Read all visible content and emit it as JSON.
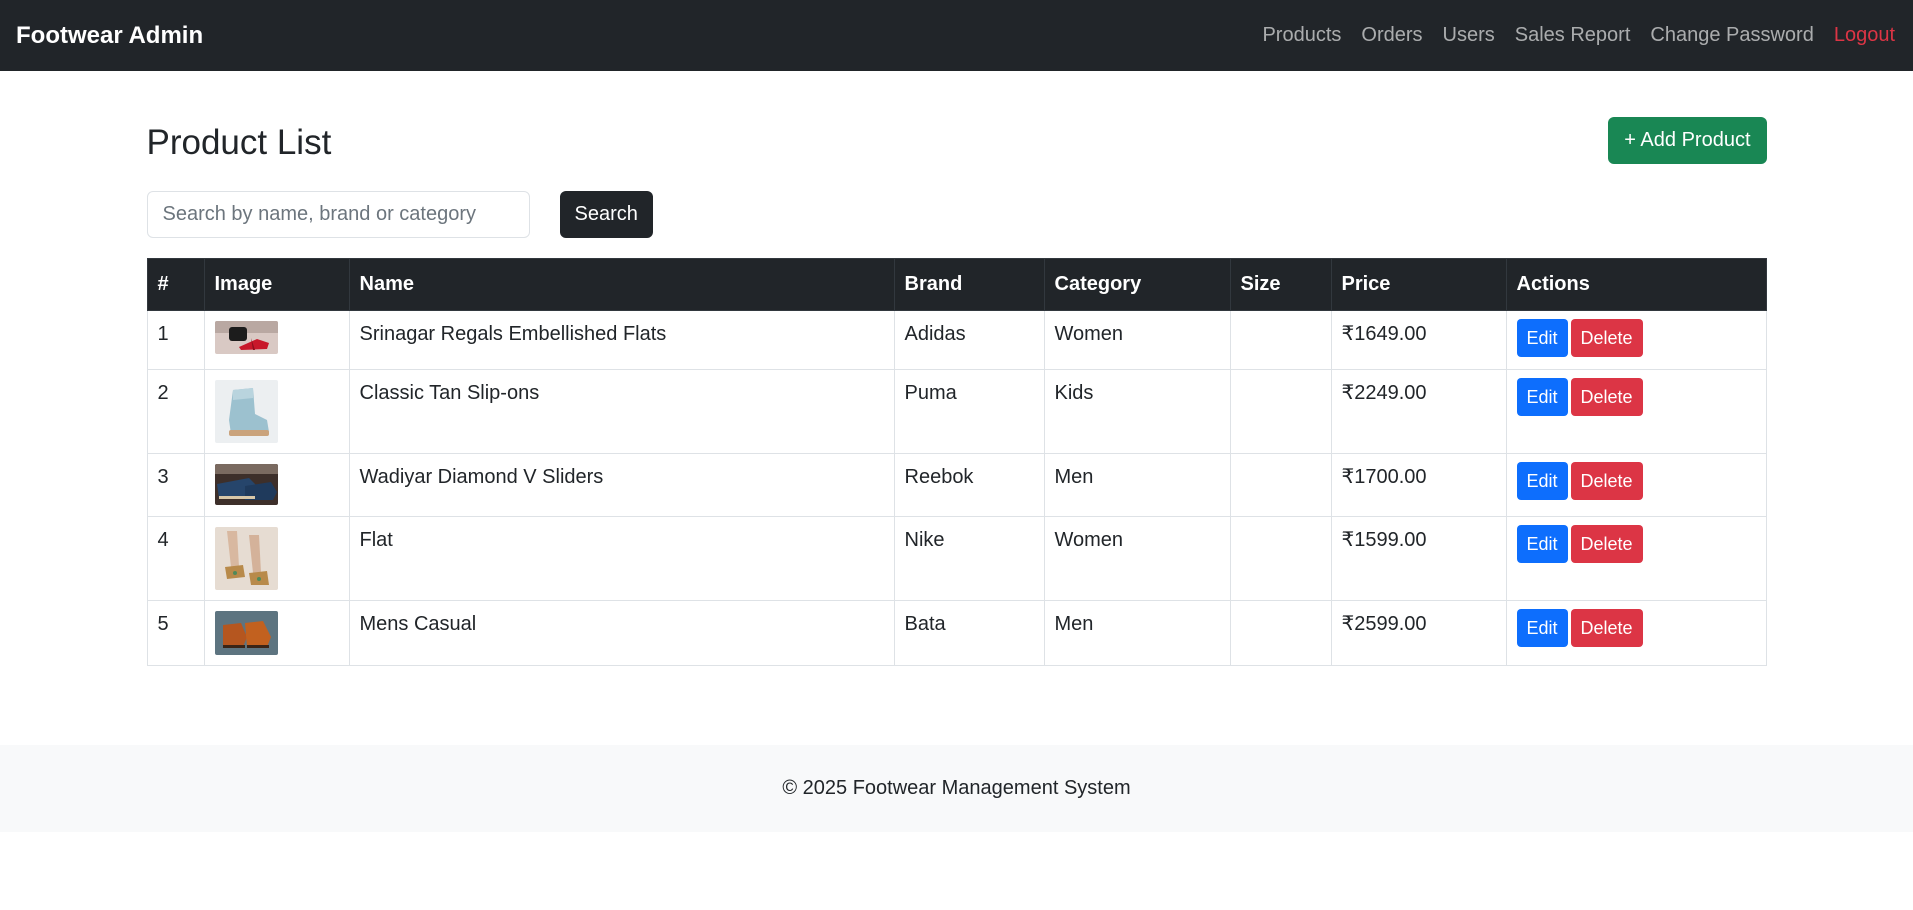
{
  "navbar": {
    "brand": "Footwear Admin",
    "links": [
      "Products",
      "Orders",
      "Users",
      "Sales Report",
      "Change Password"
    ],
    "logout": "Logout",
    "colors": {
      "background": "#212529",
      "logout": "#dc3545"
    }
  },
  "main": {
    "title": "Product List",
    "add_button": "+ Add Product",
    "search": {
      "placeholder": "Search by name, brand or category",
      "value": "",
      "button": "Search"
    },
    "table": {
      "headers": [
        "#",
        "Image",
        "Name",
        "Brand",
        "Category",
        "Size",
        "Price",
        "Actions"
      ],
      "rows": [
        {
          "num": "1",
          "image": "shoe-photo-icon",
          "name": "Srinagar Regals Embellished Flats",
          "brand": "Adidas",
          "category": "Women",
          "size": "",
          "price": "₹1649.00",
          "edit": "Edit",
          "delete": "Delete"
        },
        {
          "num": "2",
          "image": "shoe-photo-icon",
          "name": "Classic Tan Slip-ons",
          "brand": "Puma",
          "category": "Kids",
          "size": "",
          "price": "₹2249.00",
          "edit": "Edit",
          "delete": "Delete"
        },
        {
          "num": "3",
          "image": "shoe-photo-icon",
          "name": "Wadiyar Diamond V Sliders",
          "brand": "Reebok",
          "category": "Men",
          "size": "",
          "price": "₹1700.00",
          "edit": "Edit",
          "delete": "Delete"
        },
        {
          "num": "4",
          "image": "shoe-photo-icon",
          "name": "Flat",
          "brand": "Nike",
          "category": "Women",
          "size": "",
          "price": "₹1599.00",
          "edit": "Edit",
          "delete": "Delete"
        },
        {
          "num": "5",
          "image": "shoe-photo-icon",
          "name": "Mens Casual",
          "brand": "Bata",
          "category": "Men",
          "size": "",
          "price": "₹2599.00",
          "edit": "Edit",
          "delete": "Delete"
        }
      ]
    },
    "colors": {
      "add": "#198754",
      "edit": "#0d6efd",
      "delete": "#dc3545"
    }
  },
  "footer": {
    "text": "© 2025 Footwear Management System"
  }
}
